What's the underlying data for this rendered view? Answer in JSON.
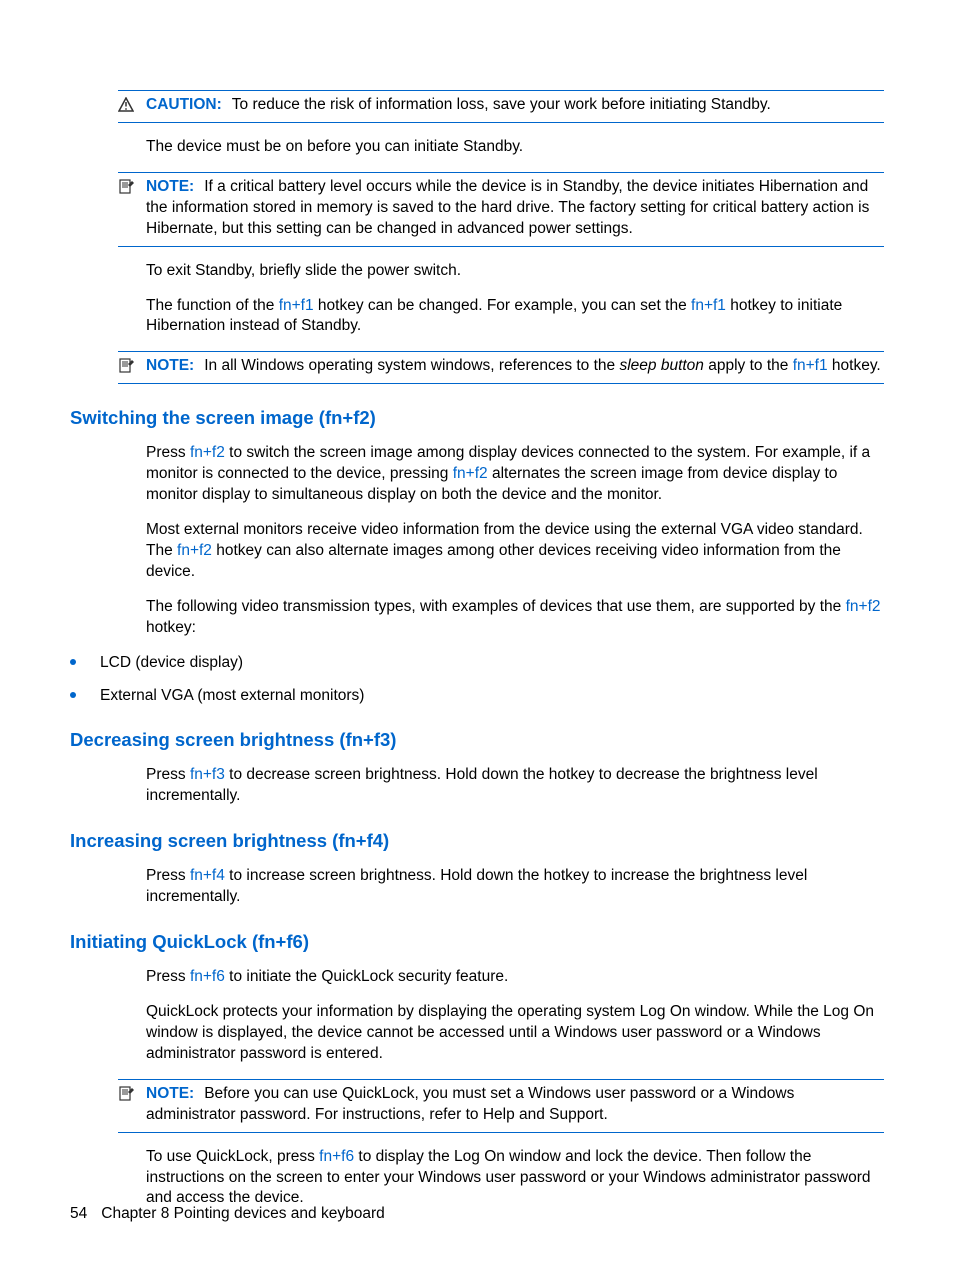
{
  "callout1": {
    "label": "CAUTION:",
    "text": "To reduce the risk of information loss, save your work before initiating Standby."
  },
  "para1": "The device must be on before you can initiate Standby.",
  "callout2": {
    "label": "NOTE:",
    "text": "If a critical battery level occurs while the device is in Standby, the device initiates Hibernation and the information stored in memory is saved to the hard drive. The factory setting for critical battery action is Hibernate, but this setting can be changed in advanced power settings."
  },
  "para2": "To exit Standby, briefly slide the power switch.",
  "para3_a": "The function of the ",
  "para3_k1": "fn+f1",
  "para3_b": " hotkey can be changed. For example, you can set the ",
  "para3_k2": "fn+f1",
  "para3_c": " hotkey to initiate Hibernation instead of Standby.",
  "callout3": {
    "label": "NOTE:",
    "t1": "In all Windows operating system windows, references to the ",
    "em": "sleep button",
    "t2": " apply to the ",
    "k": "fn+f1",
    "t3": " hotkey."
  },
  "sec_switch": {
    "title": "Switching the screen image (fn+f2)",
    "p1_a": "Press ",
    "p1_k1": "fn+f2",
    "p1_b": " to switch the screen image among display devices connected to the system. For example, if a monitor is connected to the device, pressing ",
    "p1_k2": "fn+f2",
    "p1_c": " alternates the screen image from device display to monitor display to simultaneous display on both the device and the monitor.",
    "p2_a": "Most external monitors receive video information from the device using the external VGA video standard. The ",
    "p2_k": "fn+f2",
    "p2_b": " hotkey can also alternate images among other devices receiving video information from the device.",
    "p3_a": "The following video transmission types, with examples of devices that use them, are supported by the ",
    "p3_k": "fn+f2",
    "p3_b": " hotkey:",
    "b1": "LCD (device display)",
    "b2": "External VGA (most external monitors)"
  },
  "sec_dec": {
    "title": "Decreasing screen brightness (fn+f3)",
    "p_a": "Press ",
    "p_k": "fn+f3",
    "p_b": " to decrease screen brightness. Hold down the hotkey to decrease the brightness level incrementally."
  },
  "sec_inc": {
    "title": "Increasing screen brightness (fn+f4)",
    "p_a": "Press ",
    "p_k": "fn+f4",
    "p_b": " to increase screen brightness. Hold down the hotkey to increase the brightness level incrementally."
  },
  "sec_ql": {
    "title": "Initiating QuickLock (fn+f6)",
    "p1_a": "Press ",
    "p1_k": "fn+f6",
    "p1_b": " to initiate the QuickLock security feature.",
    "p2": "QuickLock protects your information by displaying the operating system Log On window. While the Log On window is displayed, the device cannot be accessed until a Windows user password or a Windows administrator password is entered.",
    "note_label": "NOTE:",
    "note_text": "Before you can use QuickLock, you must set a Windows user password or a Windows administrator password. For instructions, refer to Help and Support.",
    "p3_a": "To use QuickLock, press ",
    "p3_k": "fn+f6",
    "p3_b": " to display the Log On window and lock the device. Then follow the instructions on the screen to enter your Windows user password or your Windows administrator password and access the device."
  },
  "footer": {
    "page": "54",
    "chapter": "Chapter 8   Pointing devices and keyboard"
  }
}
